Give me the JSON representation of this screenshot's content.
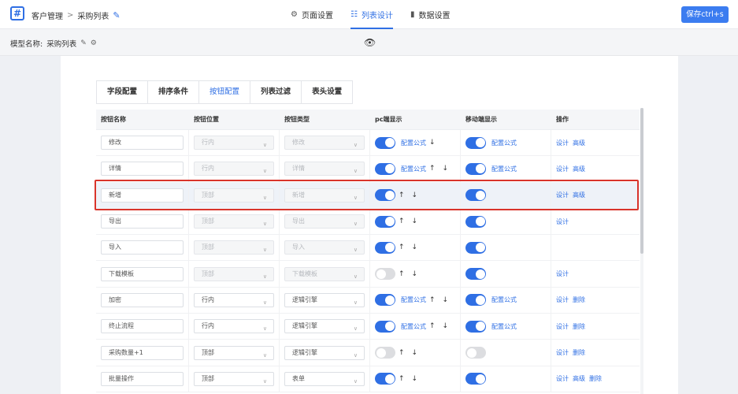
{
  "header": {
    "logo": "#",
    "breadcrumb": [
      "客户管理",
      "采购列表"
    ],
    "tabs": [
      {
        "icon": "⚙",
        "label": "页面设置",
        "active": false
      },
      {
        "icon": "☷",
        "label": "列表设计",
        "active": true
      },
      {
        "icon": "▮",
        "label": "数据设置",
        "active": false
      }
    ],
    "save_label": "保存ctrl+s"
  },
  "model": {
    "label": "模型名称:",
    "name": "采购列表"
  },
  "subtabs": [
    "字段配置",
    "排序条件",
    "按钮配置",
    "列表过滤",
    "表头设置"
  ],
  "active_subtab": "按钮配置",
  "table": {
    "headers": [
      "按钮名称",
      "按钮位置",
      "按钮类型",
      "pc端显示",
      "移动端显示",
      "操作"
    ],
    "rows": [
      {
        "name": "修改",
        "position": "行内",
        "type": "修改",
        "pos_enabled": false,
        "type_enabled": false,
        "pc_on": true,
        "pc_formula": "配置公式",
        "pc_arrows": [
          "↓"
        ],
        "mobile_on": true,
        "mobile_formula": "配置公式",
        "ops": [
          "设计",
          "高级"
        ]
      },
      {
        "name": "详情",
        "position": "行内",
        "type": "详情",
        "pos_enabled": false,
        "type_enabled": false,
        "pc_on": true,
        "pc_formula": "配置公式",
        "pc_arrows": [
          "↑",
          "↓"
        ],
        "mobile_on": true,
        "mobile_formula": "配置公式",
        "ops": [
          "设计",
          "高级"
        ]
      },
      {
        "name": "新增",
        "position": "顶部",
        "type": "新增",
        "pos_enabled": false,
        "type_enabled": false,
        "pc_on": true,
        "pc_formula": "",
        "pc_arrows": [
          "↑",
          "↓"
        ],
        "mobile_on": true,
        "mobile_formula": "",
        "ops": [
          "设计",
          "高级"
        ],
        "highlight": true
      },
      {
        "name": "导出",
        "position": "顶部",
        "type": "导出",
        "pos_enabled": false,
        "type_enabled": false,
        "pc_on": true,
        "pc_formula": "",
        "pc_arrows": [
          "↑",
          "↓"
        ],
        "mobile_on": true,
        "mobile_formula": "",
        "ops": [
          "设计"
        ]
      },
      {
        "name": "导入",
        "position": "顶部",
        "type": "导入",
        "pos_enabled": false,
        "type_enabled": false,
        "pc_on": true,
        "pc_formula": "",
        "pc_arrows": [
          "↑",
          "↓"
        ],
        "mobile_on": true,
        "mobile_formula": "",
        "ops": []
      },
      {
        "name": "下载模板",
        "position": "顶部",
        "type": "下载模板",
        "pos_enabled": false,
        "type_enabled": false,
        "pc_on": false,
        "pc_formula": "",
        "pc_arrows": [
          "↑",
          "↓"
        ],
        "mobile_on": true,
        "mobile_formula": "",
        "ops": [
          "设计"
        ]
      },
      {
        "name": "加密",
        "position": "行内",
        "type": "逻辑引擎",
        "pos_enabled": true,
        "type_enabled": true,
        "pc_on": true,
        "pc_formula": "配置公式",
        "pc_arrows": [
          "↑",
          "↓"
        ],
        "mobile_on": true,
        "mobile_formula": "配置公式",
        "ops": [
          "设计",
          "删除"
        ]
      },
      {
        "name": "终止流程",
        "position": "行内",
        "type": "逻辑引擎",
        "pos_enabled": true,
        "type_enabled": true,
        "pc_on": true,
        "pc_formula": "配置公式",
        "pc_arrows": [
          "↑",
          "↓"
        ],
        "mobile_on": true,
        "mobile_formula": "配置公式",
        "ops": [
          "设计",
          "删除"
        ]
      },
      {
        "name": "采购数量+1",
        "position": "顶部",
        "type": "逻辑引擎",
        "pos_enabled": true,
        "type_enabled": true,
        "pc_on": false,
        "pc_formula": "",
        "pc_arrows": [
          "↑",
          "↓"
        ],
        "mobile_on": false,
        "mobile_formula": "",
        "ops": [
          "设计",
          "删除"
        ]
      },
      {
        "name": "批量操作",
        "position": "顶部",
        "type": "表单",
        "pos_enabled": true,
        "type_enabled": true,
        "pc_on": true,
        "pc_formula": "",
        "pc_arrows": [
          "↑",
          "↓"
        ],
        "mobile_on": true,
        "mobile_formula": "",
        "ops": [
          "设计",
          "高级",
          "删除"
        ]
      }
    ]
  },
  "colors": {
    "accent": "#2f6fe4",
    "highlight_border": "#d9342b"
  }
}
